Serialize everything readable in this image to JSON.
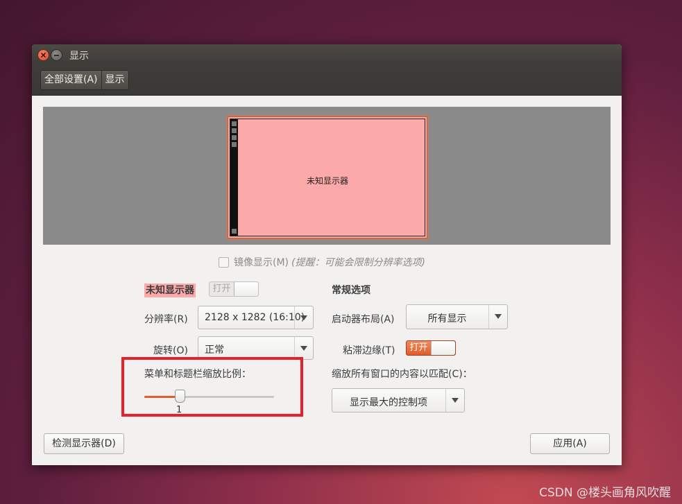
{
  "window": {
    "title": "显示"
  },
  "toolbar": {
    "breadcrumbs": [
      "全部设置(A)",
      "显示"
    ]
  },
  "preview": {
    "monitor_label": "未知显示器"
  },
  "mirror": {
    "label": "镜像显示(M)",
    "note": "(提醒：可能会限制分辨率选项)",
    "checked": false
  },
  "display": {
    "name": "未知显示器",
    "power_switch": {
      "label": "打开",
      "state": "off"
    },
    "resolution": {
      "label": "分辨率(R)",
      "value": "2128 x 1282 (16:10)"
    },
    "rotation": {
      "label": "旋转(O)",
      "value": "正常"
    },
    "scale": {
      "label": "菜单和标题栏缩放比例：",
      "value": "1",
      "fraction": 0.29
    }
  },
  "general": {
    "heading": "常规选项",
    "launcher_placement": {
      "label": "启动器布局(A)",
      "value": "所有显示"
    },
    "sticky_edges": {
      "label": "粘滞边缘(T)",
      "switch_label": "打开",
      "state": "on"
    },
    "scale_all": {
      "label": "缩放所有窗口的内容以匹配(C)：",
      "value": "显示最大的控制项"
    }
  },
  "buttons": {
    "detect": "检测显示器(D)",
    "apply": "应用(A)"
  },
  "watermark": "CSDN @楼头画角风吹醒",
  "colors": {
    "accent": "#e25d2c",
    "monitor": "#fca9aa",
    "highlight": "#e8202a"
  }
}
